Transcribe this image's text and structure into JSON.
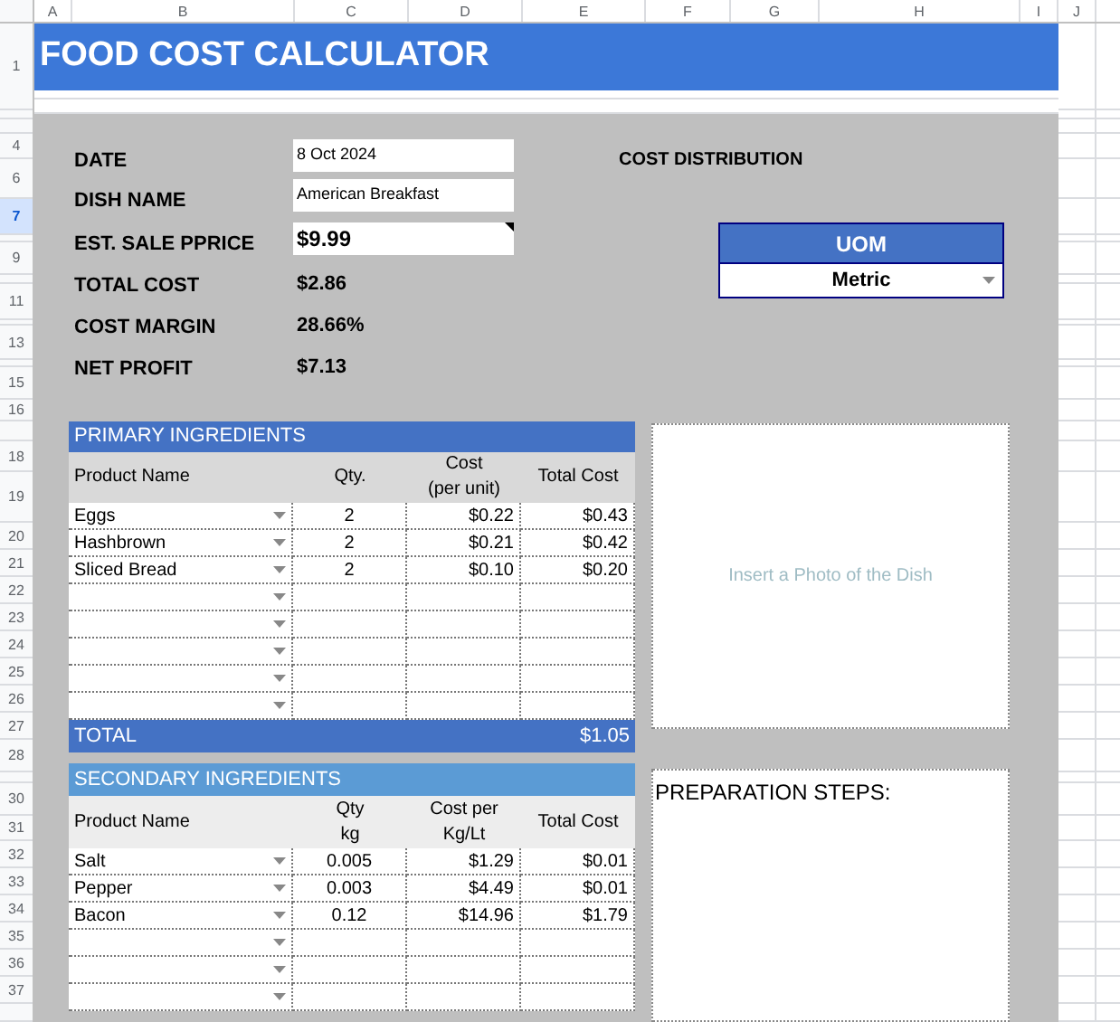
{
  "column_headers": [
    "A",
    "B",
    "C",
    "D",
    "E",
    "F",
    "G",
    "H",
    "I",
    "J"
  ],
  "row_headers": [
    {
      "label": "1",
      "selected": false
    },
    {
      "label": "4",
      "selected": false
    },
    {
      "label": "6",
      "selected": false
    },
    {
      "label": "7",
      "selected": true
    },
    {
      "label": "9",
      "selected": false
    },
    {
      "label": "11",
      "selected": false
    },
    {
      "label": "13",
      "selected": false
    },
    {
      "label": "15",
      "selected": false
    },
    {
      "label": "16",
      "selected": false
    },
    {
      "label": "18",
      "selected": false
    },
    {
      "label": "19",
      "selected": false
    },
    {
      "label": "20",
      "selected": false
    },
    {
      "label": "21",
      "selected": false
    },
    {
      "label": "22",
      "selected": false
    },
    {
      "label": "23",
      "selected": false
    },
    {
      "label": "24",
      "selected": false
    },
    {
      "label": "25",
      "selected": false
    },
    {
      "label": "26",
      "selected": false
    },
    {
      "label": "27",
      "selected": false
    },
    {
      "label": "28",
      "selected": false
    },
    {
      "label": "30",
      "selected": false
    },
    {
      "label": "31",
      "selected": false
    },
    {
      "label": "32",
      "selected": false
    },
    {
      "label": "33",
      "selected": false
    },
    {
      "label": "34",
      "selected": false
    },
    {
      "label": "35",
      "selected": false
    },
    {
      "label": "36",
      "selected": false
    },
    {
      "label": "37",
      "selected": false
    }
  ],
  "title": "FOOD COST CALCULATOR",
  "info": [
    {
      "label": "DATE",
      "value": "8 Oct 2024",
      "kind": "field"
    },
    {
      "label": "DISH NAME",
      "value": "American Breakfast",
      "kind": "field"
    },
    {
      "label": "EST. SALE PPRICE",
      "value": "$9.99",
      "kind": "price"
    },
    {
      "label": "TOTAL COST",
      "value": "$2.86",
      "kind": "readout"
    },
    {
      "label": "COST MARGIN",
      "value": "28.66%",
      "kind": "readout"
    },
    {
      "label": "NET PROFIT",
      "value": "$7.13",
      "kind": "readout"
    }
  ],
  "cost_distribution": {
    "title": "COST DISTRIBUTION"
  },
  "uom": {
    "label": "UOM",
    "value": "Metric"
  },
  "primary": {
    "title": "PRIMARY INGREDIENTS",
    "columns": [
      "Product Name",
      "Qty.",
      "Cost\n(per unit)",
      "Total Cost"
    ],
    "rows": [
      {
        "name": "Eggs",
        "qty": "2",
        "cost": "$0.22",
        "total": "$0.43"
      },
      {
        "name": "Hashbrown",
        "qty": "2",
        "cost": "$0.21",
        "total": "$0.42"
      },
      {
        "name": "Sliced Bread",
        "qty": "2",
        "cost": "$0.10",
        "total": "$0.20"
      }
    ],
    "total_label": "TOTAL",
    "total_value": "$1.05"
  },
  "secondary": {
    "title": "SECONDARY INGREDIENTS",
    "columns": [
      "Product Name",
      "Qty\nkg",
      "Cost per\nKg/Lt",
      "Total Cost"
    ],
    "rows": [
      {
        "name": "Salt",
        "qty": "0.005",
        "cost": "$1.29",
        "total": "$0.01"
      },
      {
        "name": "Pepper",
        "qty": "0.003",
        "cost": "$4.49",
        "total": "$0.01"
      },
      {
        "name": "Bacon",
        "qty": "0.12",
        "cost": "$14.96",
        "total": "$1.79"
      }
    ]
  },
  "photo": {
    "placeholder": "Insert a Photo of the Dish"
  },
  "preparation": {
    "title": "PREPARATION STEPS:"
  }
}
